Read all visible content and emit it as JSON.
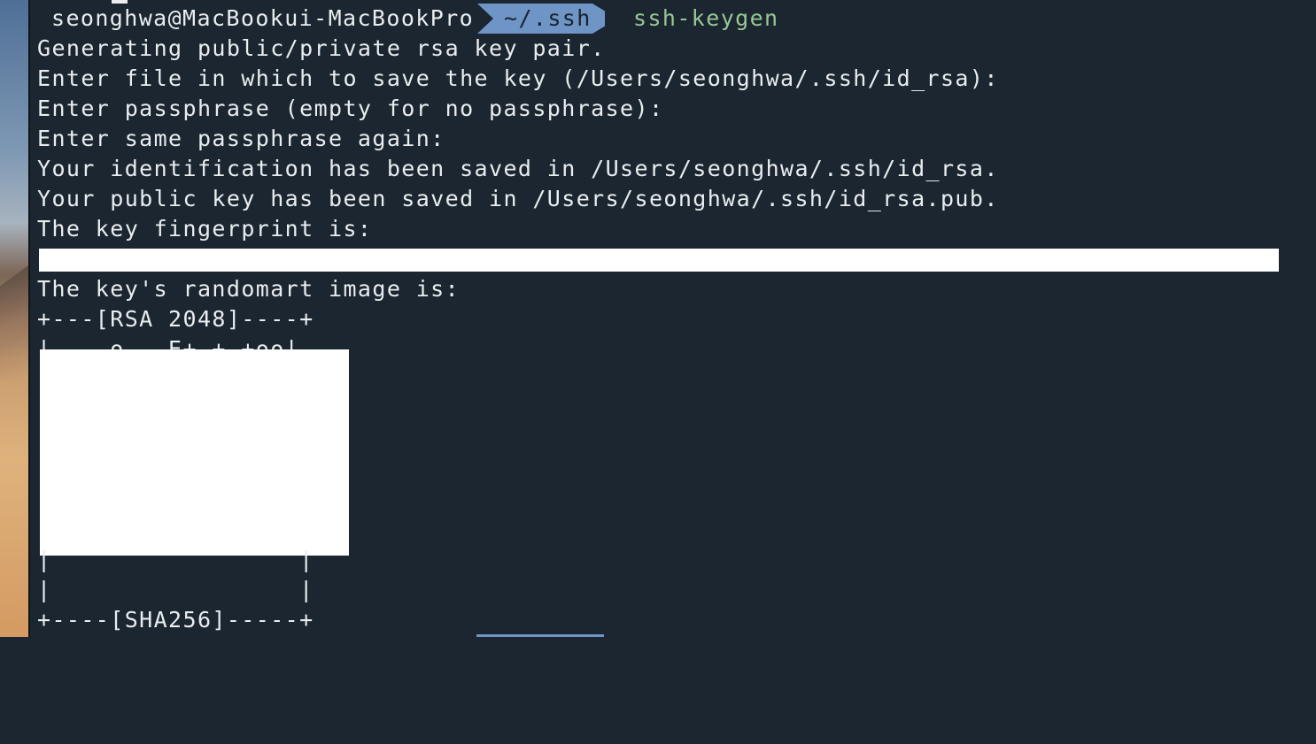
{
  "desktop": {
    "wallpaper_colors": [
      "#4f6f97",
      "#7f99b4",
      "#a7b3bf",
      "#7d6656",
      "#c69a6d",
      "#dfb27d",
      "#d49b62"
    ]
  },
  "terminal": {
    "background": "#1b2630",
    "text_color": "#e9edf0",
    "accent_color": "#6f95c7",
    "command_color": "#98c794",
    "prompt": {
      "user_host": "seonghwa@MacBookui-MacBookPro",
      "path": "~/.ssh",
      "command": "ssh-keygen"
    },
    "output": [
      "Generating public/private rsa key pair.",
      "Enter file in which to save the key (/Users/seonghwa/.ssh/id_rsa):",
      "Enter passphrase (empty for no passphrase):",
      "Enter same passphrase again:",
      "Your identification has been saved in /Users/seonghwa/.ssh/id_rsa.",
      "Your public key has been saved in /Users/seonghwa/.ssh/id_rsa.pub.",
      "The key fingerprint is:",
      "The key's randomart image is:",
      "+---[RSA 2048]----+",
      "|    o   E+ + +oo|",
      "|                 |",
      "|                 |",
      "+----[SHA256]-----+"
    ]
  }
}
